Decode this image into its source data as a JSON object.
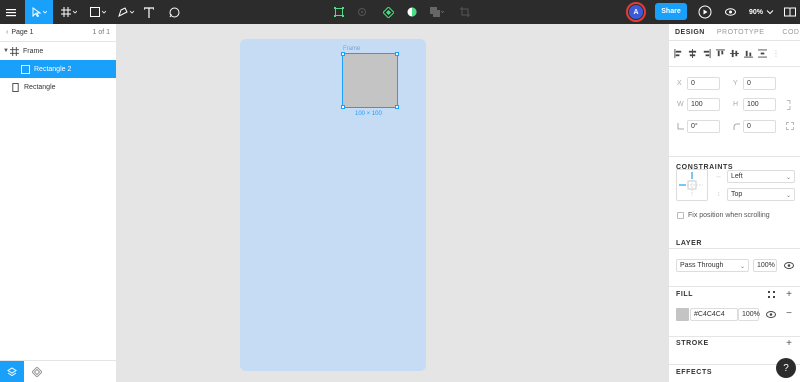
{
  "toolbar": {
    "tools": [
      "menu-icon",
      "move-tool-icon",
      "frame-tool-icon",
      "shape-tool-icon",
      "pen-tool-icon",
      "text-tool-icon",
      "comment-tool-icon"
    ],
    "center_tools": [
      "component-icon",
      "plugin-icon",
      "instance-icon",
      "contrast-icon",
      "boolean-icon",
      "crop-icon"
    ],
    "share_label": "Share",
    "avatar_initial": "A",
    "zoom_label": "90%",
    "accent_color": "#18a0fb"
  },
  "left_panel": {
    "page_name": "Page 1",
    "page_count": "1 of 1",
    "layers": [
      {
        "label": "Frame",
        "type": "frame",
        "selected": false
      },
      {
        "label": "Rectangle 2",
        "type": "rectangle",
        "selected": true
      },
      {
        "label": "Rectangle",
        "type": "rectangle",
        "selected": false
      }
    ]
  },
  "canvas": {
    "frame_label": "Frame",
    "size_label": "100 × 100",
    "frame_color": "#c6dbf4",
    "rect_color": "#c4c4c4"
  },
  "right_panel": {
    "tabs": [
      "DESIGN",
      "PROTOTYPE",
      "CODE"
    ],
    "active_tab": "DESIGN",
    "x_label": "X",
    "x_value": "0",
    "y_label": "Y",
    "y_value": "0",
    "w_label": "W",
    "w_value": "100",
    "h_label": "H",
    "h_value": "100",
    "rotation_value": "0°",
    "radius_value": "0",
    "constraints_title": "CONSTRAINTS",
    "constraint_h": "Left",
    "constraint_v": "Top",
    "fix_position_label": "Fix position when scrolling",
    "layer_title": "LAYER",
    "blend_mode": "Pass Through",
    "layer_opacity": "100%",
    "fill_title": "FILL",
    "fill_hex": "#C4C4C4",
    "fill_opacity": "100%",
    "stroke_title": "STROKE",
    "effects_title": "EFFECTS",
    "help_label": "?"
  }
}
